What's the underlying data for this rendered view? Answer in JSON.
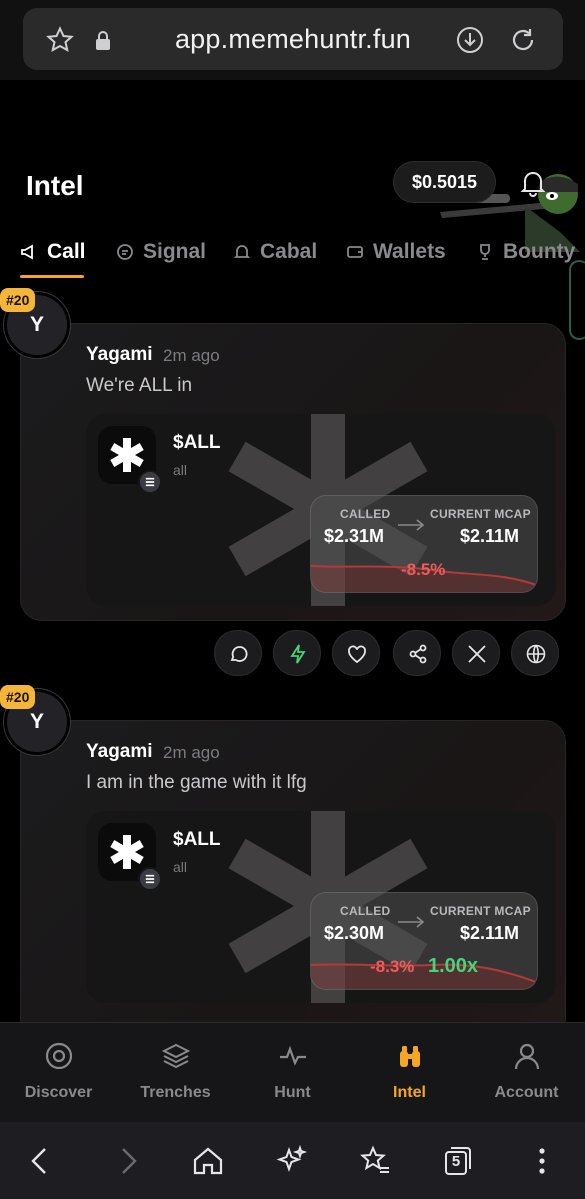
{
  "browser": {
    "url": "app.memehuntr.fun",
    "icons": [
      "star-icon",
      "lock-icon",
      "download-icon",
      "reload-icon"
    ]
  },
  "header": {
    "title": "Intel",
    "price": "$0.5015"
  },
  "tabs": [
    {
      "label": "Call",
      "icon": "megaphone-icon",
      "active": true
    },
    {
      "label": "Signal",
      "icon": "chat-icon",
      "active": false
    },
    {
      "label": "Cabal",
      "icon": "bell-icon",
      "active": false
    },
    {
      "label": "Wallets",
      "icon": "wallet-icon",
      "active": false
    },
    {
      "label": "Bounty",
      "icon": "trophy-icon",
      "active": false
    }
  ],
  "posts": [
    {
      "rank": "#20",
      "avatar_letter": "Y",
      "author": "Yagami",
      "time_ago": "2m ago",
      "message": "We're ALL in",
      "token": {
        "ticker": "$ALL",
        "name": "all"
      },
      "stats": {
        "called_label": "CALLED",
        "called_value": "$2.31M",
        "current_label": "CURRENT MCAP",
        "current_value": "$2.11M",
        "change": "-8.5%",
        "multiplier": ""
      }
    },
    {
      "rank": "#20",
      "avatar_letter": "Y",
      "author": "Yagami",
      "time_ago": "2m ago",
      "message": "I am in the game with it lfg",
      "token": {
        "ticker": "$ALL",
        "name": "all"
      },
      "stats": {
        "called_label": "CALLED",
        "called_value": "$2.30M",
        "current_label": "CURRENT MCAP",
        "current_value": "$2.11M",
        "change": "-8.3%",
        "multiplier": "1.00x"
      }
    }
  ],
  "actions": [
    "comment-icon",
    "bolt-icon",
    "heart-icon",
    "share-icon",
    "x-icon",
    "globe-icon"
  ],
  "bottom_nav": [
    {
      "label": "Discover",
      "icon": "target-icon",
      "active": false
    },
    {
      "label": "Trenches",
      "icon": "layers-icon",
      "active": false
    },
    {
      "label": "Hunt",
      "icon": "pulse-icon",
      "active": false
    },
    {
      "label": "Intel",
      "icon": "binoculars-icon",
      "active": true
    },
    {
      "label": "Account",
      "icon": "user-icon",
      "active": false
    }
  ],
  "browser_nav": {
    "tab_count": "5"
  },
  "colors": {
    "accent": "#f5a623",
    "negative": "#ef5a5a",
    "positive": "#46d37a"
  }
}
